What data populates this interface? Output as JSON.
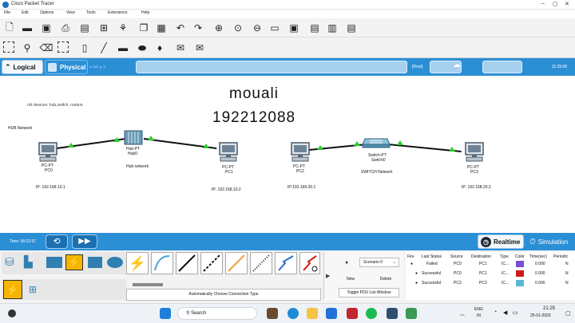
{
  "window": {
    "title": "Cisco Packet Tracer"
  },
  "menu": [
    "File",
    "Edit",
    "Options",
    "View",
    "Tools",
    "Extensions",
    "Help"
  ],
  "tabs": {
    "logical": "Logical",
    "physical": "Physical",
    "coords": "x: 147, y: 1",
    "root": "[Root]",
    "clock": "11:25:00"
  },
  "workspace": {
    "heading_name": "mouali",
    "heading_id": "192212088",
    "note": "n/k devices: hub,switch, routers",
    "hub_network_label": "HUB Network",
    "hub_network_label2": "Hub network",
    "switch_network_label": "SWITCH Network",
    "devices": {
      "pc0": {
        "type": "PC-PT",
        "name": "PC0",
        "ip": "IP: 192.168.10.1"
      },
      "hub0": {
        "type": "Hub-PT",
        "name": "Hub0"
      },
      "pc1": {
        "type": "PC-PT",
        "name": "PC1",
        "ip": "IP: 192.168.10.2"
      },
      "pc2": {
        "type": "PC-PT",
        "name": "PC2",
        "ip": "IP:192.169.20.1"
      },
      "switch0": {
        "type": "Switch-PT",
        "name": "Switch0"
      },
      "pc3": {
        "type": "PC-PT",
        "name": "PC3",
        "ip": "IP: 192.168.20.2"
      }
    }
  },
  "timebar": {
    "time": "Time: 00:22:57",
    "realtime": "Realtime",
    "simulation": "Simulation"
  },
  "bottom": {
    "connection_type": "Automatically Choose Connection Type",
    "scenario": "Scenario 0",
    "new_label": "New",
    "delete_label": "Delete",
    "toggle_label": "Toggle PDU List Window",
    "pdu_headers": [
      "Fire",
      "Last Status",
      "Source",
      "Destination",
      "Type",
      "Color",
      "Time(sec)",
      "Periodic"
    ],
    "pdu_rows": [
      {
        "status": "Failed",
        "source": "PC0",
        "destination": "PC1",
        "type": "IC...",
        "color": "#7b4fcf",
        "time": "0.000",
        "periodic": "N"
      },
      {
        "status": "Successful",
        "source": "PC0",
        "destination": "PC1",
        "type": "IC...",
        "color": "#d01b1b",
        "time": "0.000",
        "periodic": "N"
      },
      {
        "status": "Successful",
        "source": "PC2",
        "destination": "PC3",
        "type": "IC...",
        "color": "#5bb6d8",
        "time": "0.000",
        "periodic": "N"
      }
    ]
  },
  "taskbar": {
    "search": "Search",
    "lang": "ENG",
    "lang_sub": "IN",
    "time": "21:25",
    "date": "25-01-2023"
  }
}
